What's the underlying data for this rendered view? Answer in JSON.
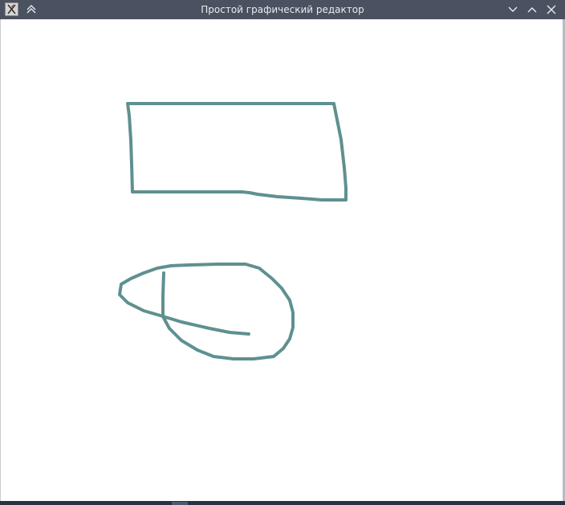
{
  "window": {
    "title": "Простой графический редактор"
  },
  "titlebar": {
    "app_icon": "x-app-icon",
    "keep_above_icon": "double-chevron-up-icon",
    "minimize_icon": "chevron-down-icon",
    "maximize_icon": "chevron-up-icon",
    "close_icon": "close-icon"
  },
  "canvas": {
    "background": "#ffffff",
    "stroke_color": "#5f9090",
    "strokes": [
      "rectangle-sketch",
      "closed-loop-sketch",
      "open-curve-sketch"
    ]
  }
}
